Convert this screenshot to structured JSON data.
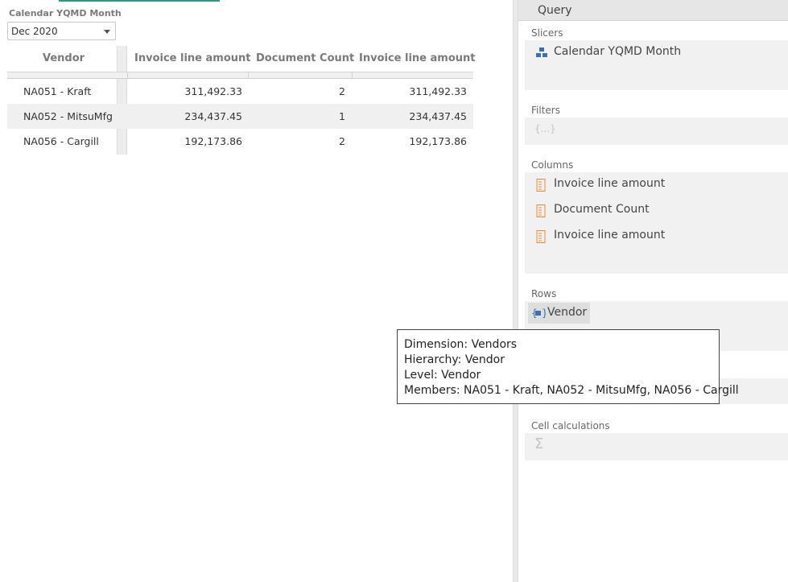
{
  "report": {
    "slicer": {
      "title": "Calendar YQMD Month",
      "selected": "Dec 2020"
    },
    "table": {
      "headers": [
        "Vendor",
        "Invoice line amount",
        "Document Count",
        "Invoice line amount"
      ],
      "rows": [
        [
          "NA051 - Kraft",
          "311,492.33",
          "2",
          "311,492.33"
        ],
        [
          "NA052 - MitsuMfg",
          "234,437.45",
          "1",
          "234,437.45"
        ],
        [
          "NA056 - Cargill",
          "192,173.86",
          "2",
          "192,173.86"
        ]
      ]
    }
  },
  "query": {
    "title": "Query",
    "slicers": {
      "label": "Slicers",
      "items": [
        "Calendar YQMD Month"
      ]
    },
    "filters": {
      "label": "Filters",
      "placeholder": "{...}"
    },
    "columns": {
      "label": "Columns",
      "items": [
        "Invoice line amount",
        "Document Count",
        "Invoice line amount"
      ]
    },
    "rows": {
      "label": "Rows",
      "items": [
        "Vendor"
      ]
    },
    "cell_calculations": {
      "label": "Cell calculations",
      "placeholder": "Σ"
    }
  },
  "tooltip": {
    "lines": [
      "Dimension: Vendors",
      "Hierarchy: Vendor",
      "Level: Vendor",
      "Members: NA051 - Kraft, NA052 - MitsuMfg, NA056 - Cargill"
    ]
  },
  "icons": {
    "hierarchy": "hierarchy-icon",
    "measure": "measure-icon",
    "dimension": "dimension-set-icon",
    "sigma": "sigma-icon"
  },
  "colors": {
    "accent": "#2a9a86",
    "measure_icon": "#e8893a",
    "hierarchy_icon": "#3a6fb0"
  }
}
